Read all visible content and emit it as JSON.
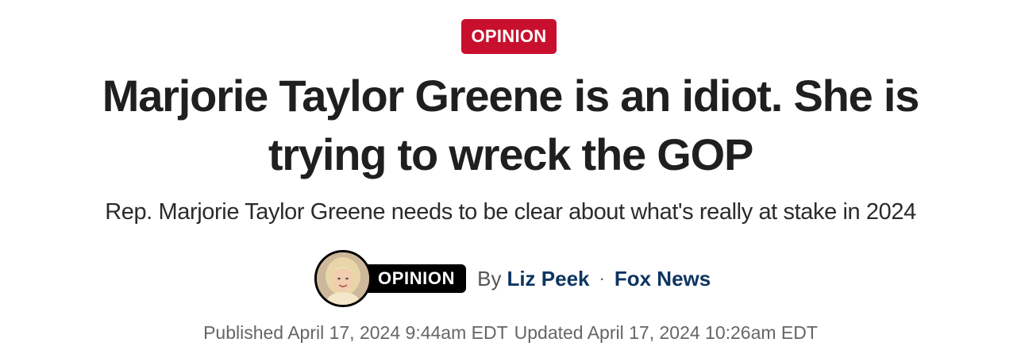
{
  "article": {
    "eyebrow": "OPINION",
    "headline": "Marjorie Taylor Greene is an idiot. She is trying to wreck the GOP",
    "subheadline": "Rep. Marjorie Taylor Greene needs to be clear about what's really at stake in 2024",
    "byline": {
      "badge": "OPINION",
      "by": "By",
      "author": "Liz Peek",
      "separator": "·",
      "outlet": "Fox News"
    },
    "published": "Published April 17, 2024 9:44am EDT",
    "updated": "Updated April 17, 2024 10:26am EDT"
  },
  "colors": {
    "eyebrow_bg": "#c8102e",
    "link": "#0e3561",
    "badge_bg": "#000000"
  }
}
